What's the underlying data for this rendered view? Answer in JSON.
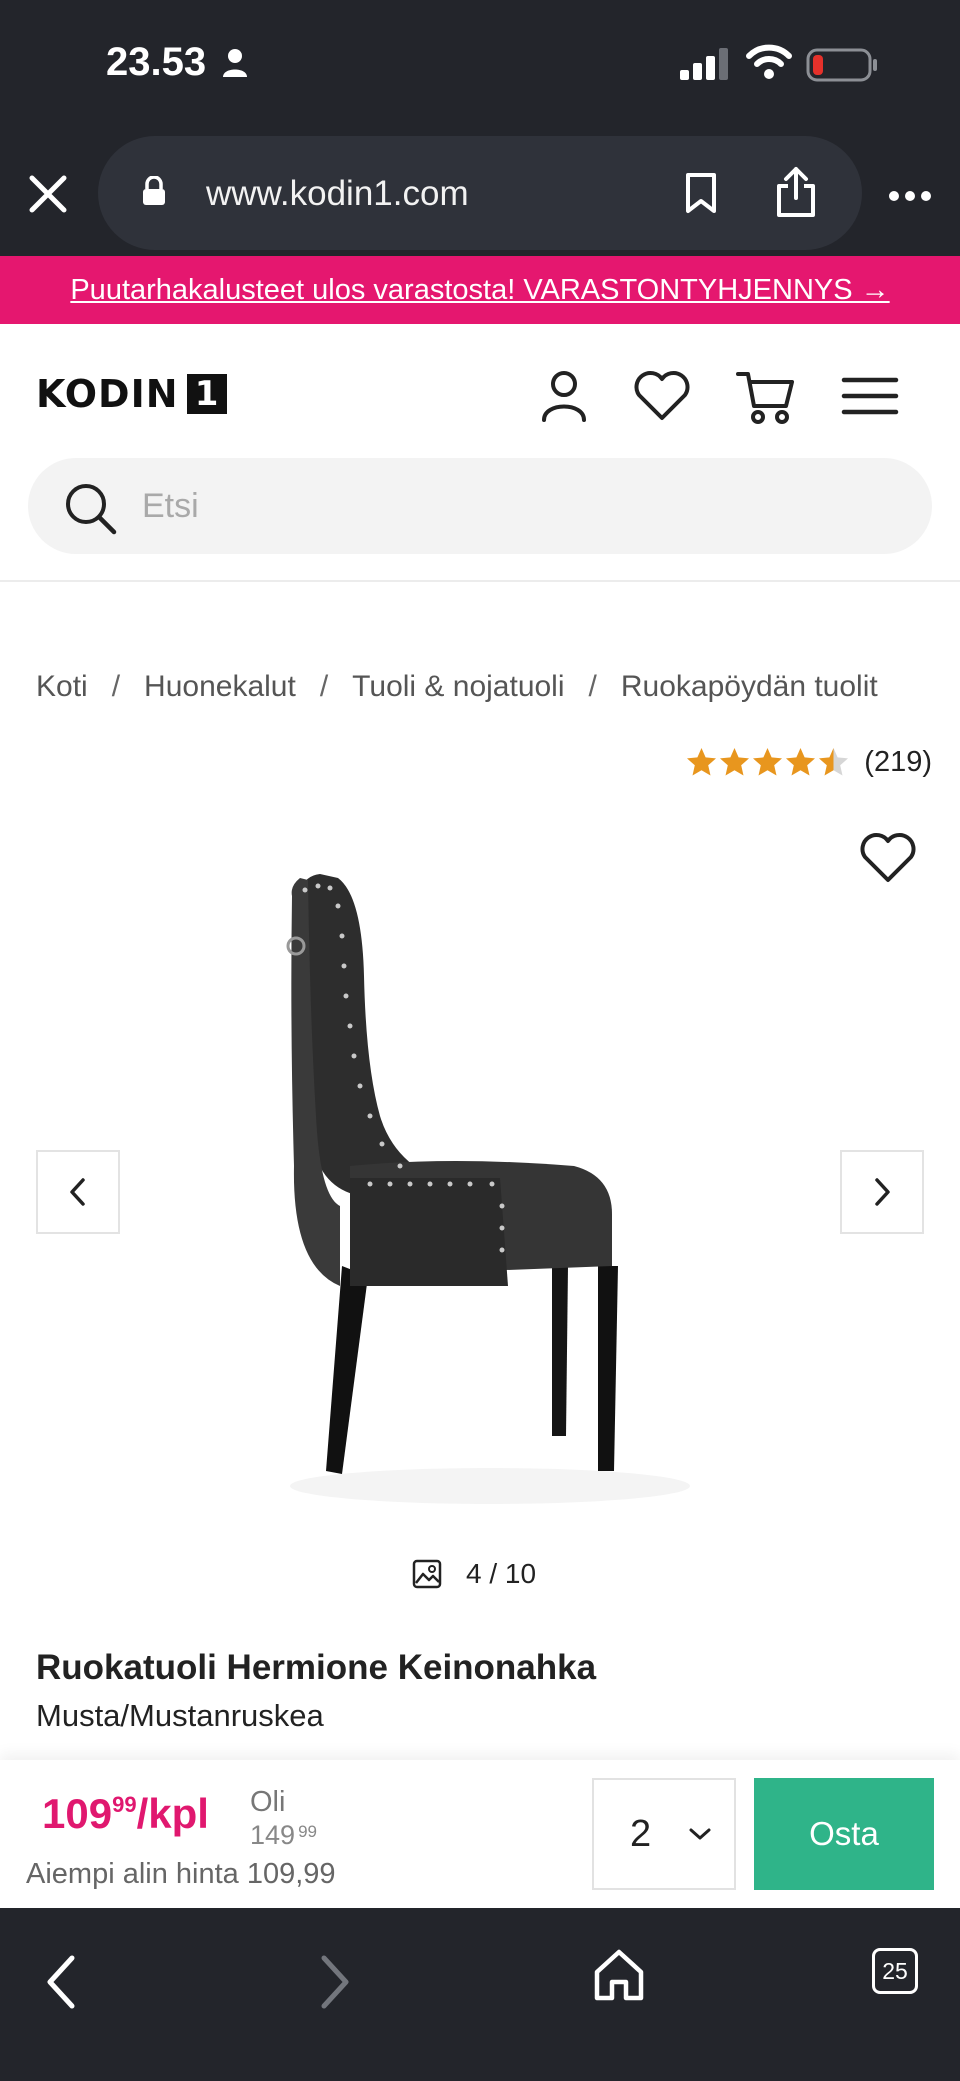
{
  "status_bar": {
    "time": "23.53"
  },
  "browser": {
    "url": "www.kodin1.com",
    "tab_count": "25"
  },
  "promo": {
    "text": "Puutarhakalusteet ulos varastosta! VARASTONTYHJENNYS →"
  },
  "header": {
    "logo_text": "KODIN",
    "logo_box": "1",
    "search_placeholder": "Etsi"
  },
  "breadcrumb": {
    "items": [
      "Koti",
      "Huonekalut",
      "Tuoli & nojatuoli",
      "Ruokapöydän tuolit"
    ],
    "separator": "/"
  },
  "rating": {
    "stars": 4.5,
    "max": 5,
    "count": "(219)",
    "star_color": "#e8961e"
  },
  "gallery": {
    "counter": "4 / 10",
    "current": 4,
    "total": 10
  },
  "product": {
    "title": "Ruokatuoli Hermione Keinonahka",
    "variant": "Musta/Mustanruskea"
  },
  "buy_bar": {
    "price_int": "109",
    "price_dec": "99",
    "price_unit": "/kpl",
    "was_label": "Oli",
    "was_int": "149",
    "was_dec": "99",
    "lowest_text": "Aiempi alin hinta 109,99",
    "quantity": "2",
    "buy_label": "Osta"
  },
  "colors": {
    "brand_pink": "#e5176f",
    "buy_green": "#2fb489",
    "chrome": "#23252b"
  }
}
